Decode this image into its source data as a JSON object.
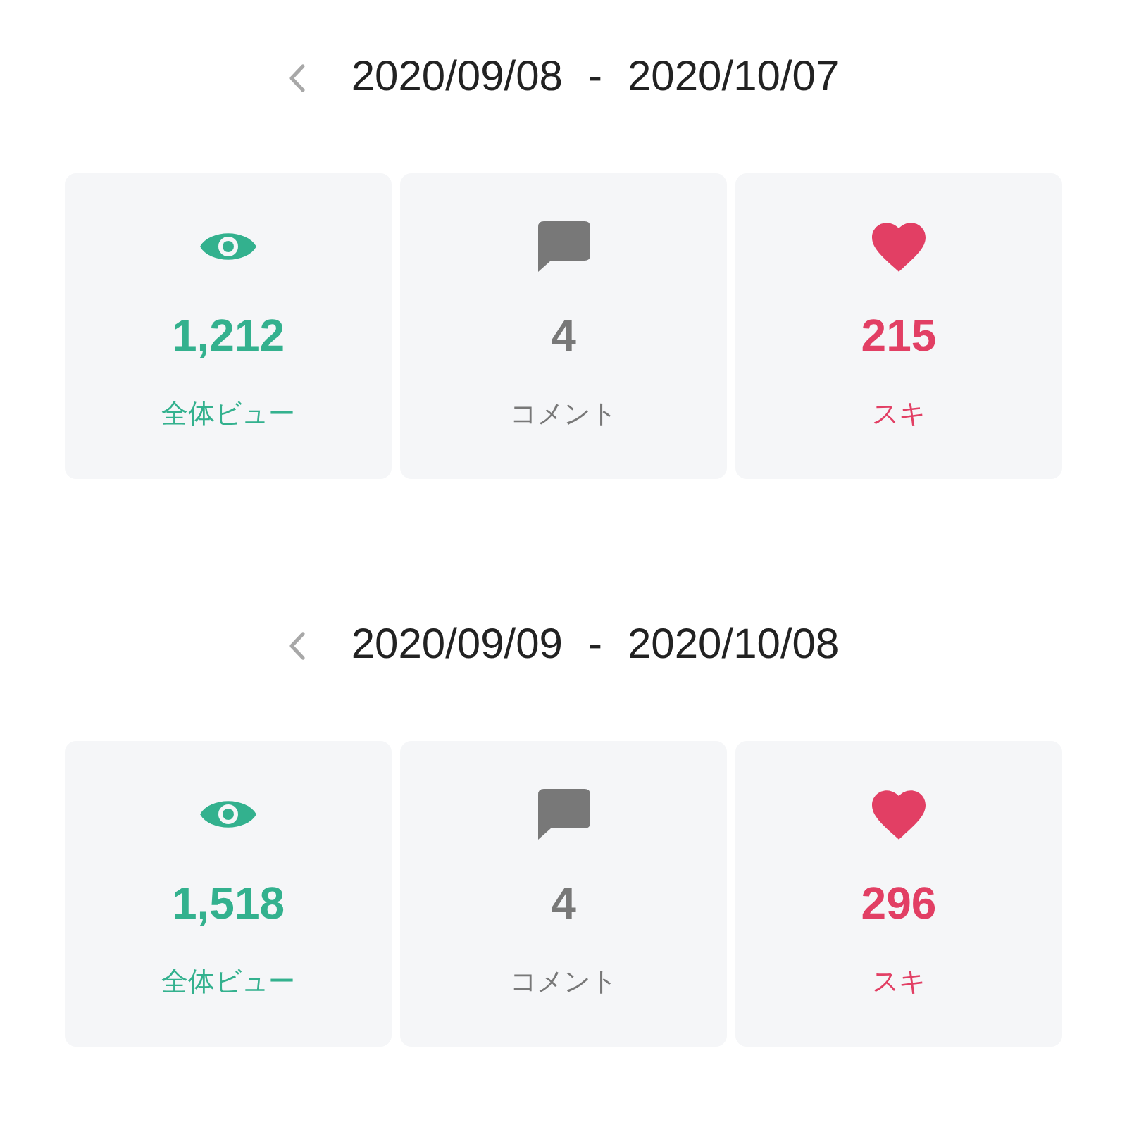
{
  "sections": [
    {
      "range": {
        "start": "2020/09/08",
        "separator": "-",
        "end": "2020/10/07"
      },
      "stats": [
        {
          "kind": "views",
          "value": "1,212",
          "label": "全体ビュー",
          "color": "#33b18e"
        },
        {
          "kind": "comments",
          "value": "4",
          "label": "コメント",
          "color": "#787878"
        },
        {
          "kind": "likes",
          "value": "215",
          "label": "スキ",
          "color": "#e23f64"
        }
      ]
    },
    {
      "range": {
        "start": "2020/09/09",
        "separator": "-",
        "end": "2020/10/08"
      },
      "stats": [
        {
          "kind": "views",
          "value": "1,518",
          "label": "全体ビュー",
          "color": "#33b18e"
        },
        {
          "kind": "comments",
          "value": "4",
          "label": "コメント",
          "color": "#787878"
        },
        {
          "kind": "likes",
          "value": "296",
          "label": "スキ",
          "color": "#e23f64"
        }
      ]
    }
  ]
}
